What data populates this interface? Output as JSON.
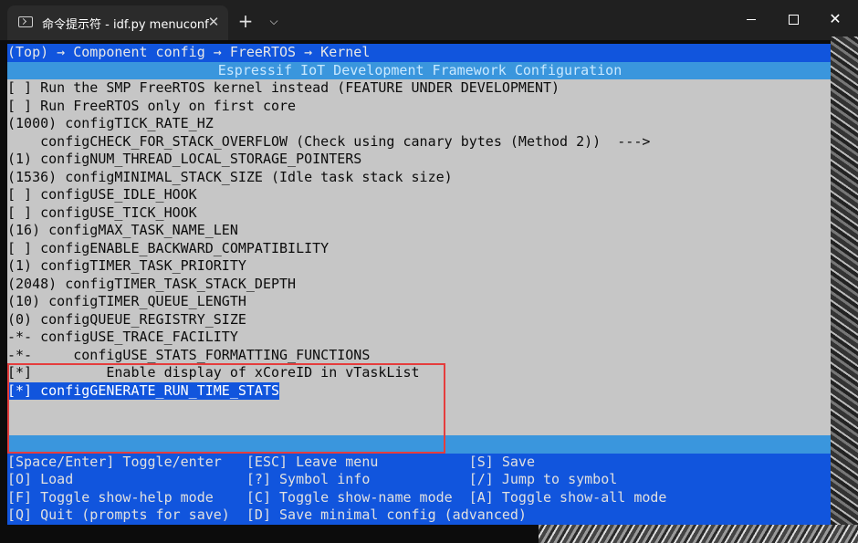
{
  "window": {
    "tab_title": "命令提示符 - idf.py  menuconf",
    "close_glyph": "✕",
    "new_tab_glyph": "+",
    "dropdown_glyph": "⌵",
    "close_window_glyph": "✕"
  },
  "terminal": {
    "breadcrumb": "(Top) → Component config → FreeRTOS → Kernel",
    "header": "Espressif IoT Development Framework Configuration",
    "items": [
      "[ ] Run the SMP FreeRTOS kernel instead (FEATURE UNDER DEVELOPMENT)",
      "[ ] Run FreeRTOS only on first core",
      "(1000) configTICK_RATE_HZ",
      "    configCHECK_FOR_STACK_OVERFLOW (Check using canary bytes (Method 2))  --->",
      "(1) configNUM_THREAD_LOCAL_STORAGE_POINTERS",
      "(1536) configMINIMAL_STACK_SIZE (Idle task stack size)",
      "[ ] configUSE_IDLE_HOOK",
      "[ ] configUSE_TICK_HOOK",
      "(16) configMAX_TASK_NAME_LEN",
      "[ ] configENABLE_BACKWARD_COMPATIBILITY",
      "(1) configTIMER_TASK_PRIORITY",
      "(2048) configTIMER_TASK_STACK_DEPTH",
      "(10) configTIMER_QUEUE_LENGTH",
      "(0) configQUEUE_REGISTRY_SIZE",
      "-*- configUSE_TRACE_FACILITY",
      "-*-     configUSE_STATS_FORMATTING_FUNCTIONS",
      "[*]         Enable display of xCoreID in vTaskList"
    ],
    "selected_item": "[*] configGENERATE_RUN_TIME_STATS",
    "help": [
      "[Space/Enter] Toggle/enter   [ESC] Leave menu           [S] Save",
      "[O] Load                     [?] Symbol info            [/] Jump to symbol",
      "[F] Toggle show-help mode    [C] Toggle show-name mode  [A] Toggle show-all mode",
      "[Q] Quit (prompts for save)  [D] Save minimal config (advanced)"
    ]
  },
  "colors": {
    "menu_blue": "#1155dd",
    "header_cyan": "#3a96dd",
    "list_grey": "#c6c6c6",
    "highlight_box": "#e53d3d"
  }
}
